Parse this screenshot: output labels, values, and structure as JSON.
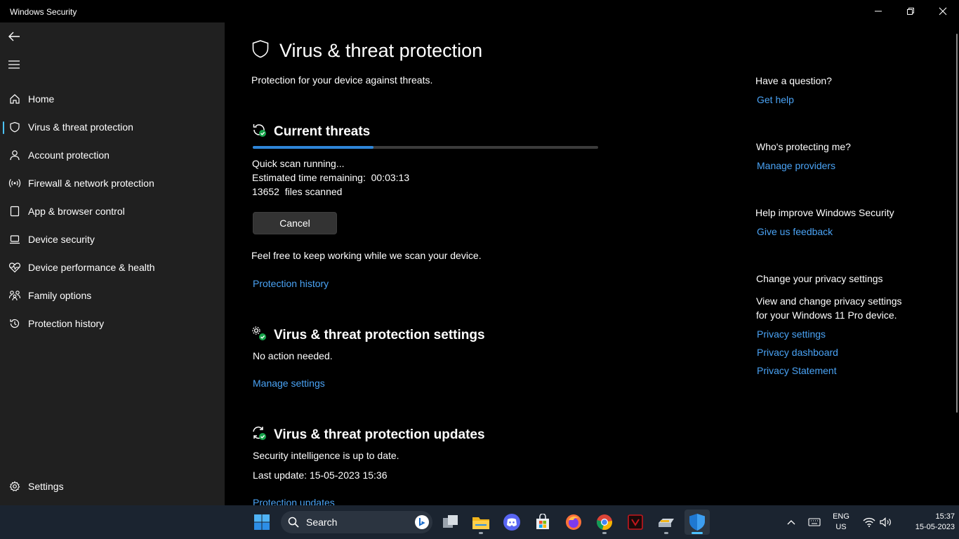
{
  "window": {
    "title": "Windows Security"
  },
  "sidebar": {
    "items": [
      {
        "label": "Home"
      },
      {
        "label": "Virus & threat protection"
      },
      {
        "label": "Account protection"
      },
      {
        "label": "Firewall & network protection"
      },
      {
        "label": "App & browser control"
      },
      {
        "label": "Device security"
      },
      {
        "label": "Device performance & health"
      },
      {
        "label": "Family options"
      },
      {
        "label": "Protection history"
      }
    ],
    "settings_label": "Settings"
  },
  "main": {
    "title": "Virus & threat protection",
    "subtitle": "Protection for your device against threats.",
    "current_threats": {
      "title": "Current threats",
      "progress_percent": 35,
      "status": "Quick scan running...",
      "estimated_label": "Estimated time remaining:",
      "estimated_value": "00:03:13",
      "files_count": "13652",
      "files_label": "files scanned",
      "cancel_label": "Cancel",
      "info": "Feel free to keep working while we scan your device.",
      "history_link": "Protection history"
    },
    "settings_section": {
      "title": "Virus & threat protection settings",
      "status": "No action needed.",
      "link": "Manage settings"
    },
    "updates_section": {
      "title": "Virus & threat protection updates",
      "status": "Security intelligence is up to date.",
      "last_update": "Last update: 15-05-2023 15:36",
      "link": "Protection updates"
    }
  },
  "right_panel": {
    "question": {
      "heading": "Have a question?",
      "link": "Get help"
    },
    "protecting": {
      "heading": "Who's protecting me?",
      "link": "Manage providers"
    },
    "improve": {
      "heading": "Help improve Windows Security",
      "link": "Give us feedback"
    },
    "privacy": {
      "heading": "Change your privacy settings",
      "text_line1": "View and change privacy settings",
      "text_line2": "for your Windows 11 Pro device.",
      "links": [
        "Privacy settings",
        "Privacy dashboard",
        "Privacy Statement"
      ]
    }
  },
  "taskbar": {
    "search_placeholder": "Search",
    "language_line1": "ENG",
    "language_line2": "US",
    "time": "15:37",
    "date": "15-05-2023"
  },
  "colors": {
    "accent": "#4cc2ff",
    "link": "#4aa3f5",
    "progress": "#2e85d8",
    "sidebar_bg": "#202020",
    "taskbar_bg": "#1b2430"
  }
}
